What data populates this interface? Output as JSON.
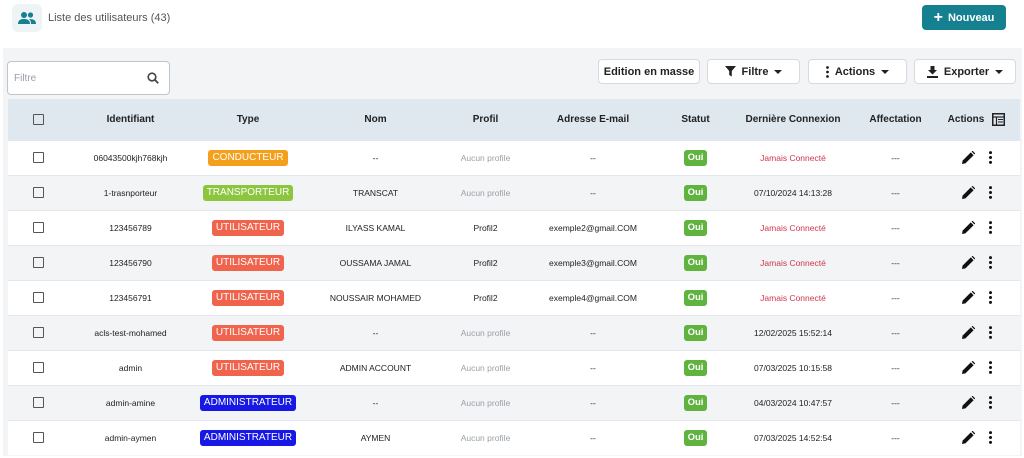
{
  "header": {
    "title": "Liste des utilisateurs (43)",
    "new_button": "Nouveau"
  },
  "toolbar": {
    "filter_placeholder": "Filtre",
    "bulk_edit": "Edition en masse",
    "filter_button": "Filtre",
    "actions_button": "Actions",
    "export_button": "Exporter"
  },
  "table": {
    "columns": [
      "Identifiant",
      "Type",
      "Nom",
      "Profil",
      "Adresse E-mail",
      "Statut",
      "Dernière Connexion",
      "Affectation",
      "Actions"
    ],
    "rows": [
      {
        "id": "06043500kjh768kjh",
        "type": "CONDUCTEUR",
        "nom": "--",
        "profil": "Aucun profile",
        "email": "--",
        "statut": "Oui",
        "connexion": "Jamais Connecté",
        "affectation": "---"
      },
      {
        "id": "1-trasnporteur",
        "type": "TRANSPORTEUR",
        "nom": "TRANSCAT",
        "profil": "Aucun profile",
        "email": "--",
        "statut": "Oui",
        "connexion": "07/10/2024 14:13:28",
        "affectation": "---"
      },
      {
        "id": "123456789",
        "type": "UTILISATEUR",
        "nom": "ILYASS KAMAL",
        "profil": "Profil2",
        "email": "exemple2@gmail.COM",
        "statut": "Oui",
        "connexion": "Jamais Connecté",
        "affectation": "---"
      },
      {
        "id": "123456790",
        "type": "UTILISATEUR",
        "nom": "OUSSAMA JAMAL",
        "profil": "Profil2",
        "email": "exemple3@gmail.COM",
        "statut": "Oui",
        "connexion": "Jamais Connecté",
        "affectation": "---"
      },
      {
        "id": "123456791",
        "type": "UTILISATEUR",
        "nom": "NOUSSAIR MOHAMED",
        "profil": "Profil2",
        "email": "exemple4@gmail.COM",
        "statut": "Oui",
        "connexion": "Jamais Connecté",
        "affectation": "---"
      },
      {
        "id": "acls-test-mohamed",
        "type": "UTILISATEUR",
        "nom": "--",
        "profil": "Aucun profile",
        "email": "--",
        "statut": "Oui",
        "connexion": "12/02/2025 15:52:14",
        "affectation": "---"
      },
      {
        "id": "admin",
        "type": "UTILISATEUR",
        "nom": "ADMIN ACCOUNT",
        "profil": "Aucun profile",
        "email": "--",
        "statut": "Oui",
        "connexion": "07/03/2025 10:15:58",
        "affectation": "---"
      },
      {
        "id": "admin-amine",
        "type": "ADMINISTRATEUR",
        "nom": "--",
        "profil": "Aucun profile",
        "email": "--",
        "statut": "Oui",
        "connexion": "04/03/2024 10:47:57",
        "affectation": "---"
      },
      {
        "id": "admin-aymen",
        "type": "ADMINISTRATEUR",
        "nom": "AYMEN",
        "profil": "Aucun profile",
        "email": "--",
        "statut": "Oui",
        "connexion": "07/03/2025 14:52:54",
        "affectation": "---"
      }
    ]
  },
  "type_colors": {
    "CONDUCTEUR": "#f5a01c",
    "TRANSPORTEUR": "#8cc63f",
    "UTILISATEUR": "#f0634d",
    "ADMINISTRATEUR": "#1717e6"
  },
  "colors": {
    "accent": "#15808f",
    "status_ok": "#60b33f",
    "never_connected": "#d0354e"
  },
  "icons": {
    "header": "users-icon",
    "search": "search-icon",
    "filter": "funnel-icon",
    "actions": "more-vertical-icon",
    "export": "download-icon",
    "columns": "column-settings-icon",
    "edit": "pencil-icon",
    "row_menu": "more-vertical-icon"
  }
}
